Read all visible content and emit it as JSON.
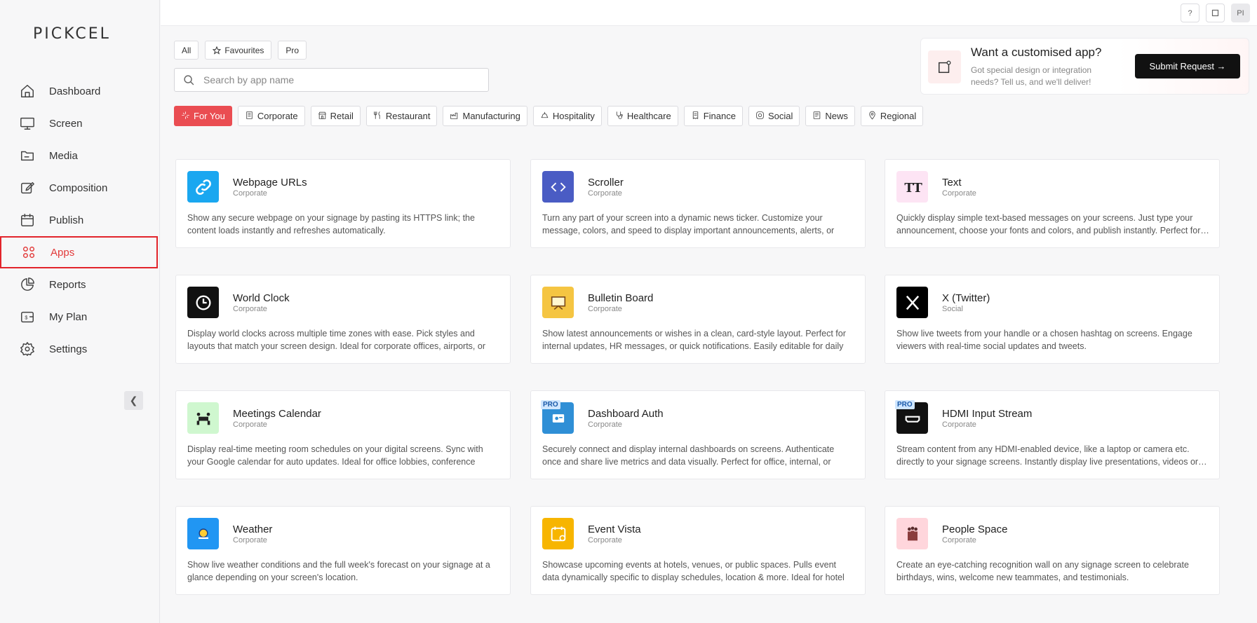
{
  "brand": "PICKCEL",
  "nav": [
    {
      "label": "Dashboard",
      "icon": "home-icon"
    },
    {
      "label": "Screen",
      "icon": "monitor-icon"
    },
    {
      "label": "Media",
      "icon": "folder-icon"
    },
    {
      "label": "Composition",
      "icon": "edit-icon"
    },
    {
      "label": "Publish",
      "icon": "calendar-icon"
    },
    {
      "label": "Apps",
      "icon": "grid-icon"
    },
    {
      "label": "Reports",
      "icon": "pie-chart-icon"
    },
    {
      "label": "My Plan",
      "icon": "wallet-icon"
    },
    {
      "label": "Settings",
      "icon": "gear-icon"
    }
  ],
  "active_nav": "Apps",
  "topbar": {
    "help": "?",
    "avatar": "PI"
  },
  "filters": [
    {
      "label": "All"
    },
    {
      "label": "Favourites",
      "icon": "star-icon"
    },
    {
      "label": "Pro"
    }
  ],
  "search": {
    "placeholder": "Search by app name"
  },
  "promo": {
    "title": "Want a customised app?",
    "desc": "Got special design or integration needs? Tell us, and we'll deliver!",
    "button": "Submit Request →"
  },
  "categories": [
    {
      "label": "For You",
      "icon": "sparkle-icon"
    },
    {
      "label": "Corporate",
      "icon": "building-icon"
    },
    {
      "label": "Retail",
      "icon": "store-icon"
    },
    {
      "label": "Restaurant",
      "icon": "utensils-icon"
    },
    {
      "label": "Manufacturing",
      "icon": "factory-icon"
    },
    {
      "label": "Hospitality",
      "icon": "bell-icon"
    },
    {
      "label": "Healthcare",
      "icon": "stethoscope-icon"
    },
    {
      "label": "Finance",
      "icon": "receipt-icon"
    },
    {
      "label": "Social",
      "icon": "instagram-icon"
    },
    {
      "label": "News",
      "icon": "newspaper-icon"
    },
    {
      "label": "Regional",
      "icon": "map-pin-icon"
    }
  ],
  "apps": [
    {
      "title": "Webpage URLs",
      "category": "Corporate",
      "desc": "Show any secure webpage on your signage by pasting its HTTPS link; the content loads instantly and refreshes automatically.",
      "icon": "link-icon",
      "color": "#1aa7f0",
      "pro": false
    },
    {
      "title": "Scroller",
      "category": "Corporate",
      "desc": "Turn any part of your screen into a dynamic news ticker. Customize your message, colors, and speed to display important announcements, alerts, or promotions as …",
      "icon": "code-icon",
      "color": "#4a5cc4",
      "pro": false
    },
    {
      "title": "Text",
      "category": "Corporate",
      "desc": "Quickly display simple text-based messages on your screens. Just type your announcement, choose your fonts and colors, and publish instantly. Perfect for…",
      "icon": "text-icon",
      "color": "#fde4f4",
      "pro": false
    },
    {
      "title": "World Clock",
      "category": "Corporate",
      "desc": "Display world clocks across multiple time zones with ease. Pick styles and layouts that match your screen design. Ideal for corporate offices, airports, or newsrooms.",
      "icon": "clock-icon",
      "color": "#111111",
      "pro": false
    },
    {
      "title": "Bulletin Board",
      "category": "Corporate",
      "desc": "Show latest announcements or wishes in a clean, card-style layout. Perfect for internal updates, HR messages, or quick notifications. Easily editable for daily or…",
      "icon": "board-icon",
      "color": "#f5c542",
      "pro": false
    },
    {
      "title": "X (Twitter)",
      "category": "Social",
      "desc": "Show live tweets from your handle or a chosen hashtag on screens. Engage viewers with real-time social updates and tweets.",
      "icon": "x-icon",
      "color": "#000000",
      "pro": false
    },
    {
      "title": "Meetings Calendar",
      "category": "Corporate",
      "desc": "Display real-time meeting room schedules on your digital screens. Sync with your Google calendar for auto updates. Ideal for office lobbies, conference rooms, and…",
      "icon": "meeting-icon",
      "color": "#cff7cf",
      "pro": false
    },
    {
      "title": "Dashboard Auth",
      "category": "Corporate",
      "desc": "Securely connect and display internal dashboards on screens. Authenticate once and share live metrics and data visually. Perfect for office, internal, or sales…",
      "icon": "dashboard-icon",
      "color": "#2f8fd6",
      "pro": true
    },
    {
      "title": "HDMI Input Stream",
      "category": "Corporate",
      "desc": "Stream content from any HDMI-enabled device, like a laptop or camera etc. directly to your signage screens. Instantly display live presentations, videos or…",
      "icon": "hdmi-icon",
      "color": "#111111",
      "pro": true
    },
    {
      "title": "Weather",
      "category": "Corporate",
      "desc": "Show live weather conditions and the full week's forecast on your signage at a glance depending on your screen's location.",
      "icon": "weather-icon",
      "color": "#2196f3",
      "pro": false
    },
    {
      "title": "Event Vista",
      "category": "Corporate",
      "desc": "Showcase upcoming events at hotels, venues, or public spaces. Pulls event data dynamically specific to display schedules, location & more. Ideal for hotel lobbies,…",
      "icon": "event-icon",
      "color": "#f7b500",
      "pro": false
    },
    {
      "title": "People Space",
      "category": "Corporate",
      "desc": "Create an eye-catching recognition wall on any signage screen to celebrate birthdays, wins, welcome new teammates, and testimonials.",
      "icon": "people-icon",
      "color": "#ffd6dc",
      "pro": false
    }
  ],
  "pro_badge": "PRO"
}
